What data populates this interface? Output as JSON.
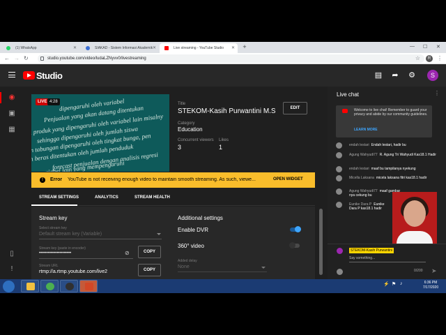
{
  "browser": {
    "tabs": [
      {
        "label": "(1) WhatsApp",
        "icon": "whatsapp-icon",
        "color": "#25d366"
      },
      {
        "label": "SIAKAD - Sistem Informasi Akademik",
        "icon": "siakad-icon",
        "color": "#3b6fd4"
      },
      {
        "label": "Live streaming - YouTube Studio",
        "icon": "youtube-icon",
        "color": "#ff0000"
      }
    ],
    "url": "studio.youtube.com/video/ludaLZNyvv0/livestreaming",
    "profile_initial": "R"
  },
  "studio": {
    "logo_text": "Studio",
    "avatar_initial": "S"
  },
  "stream": {
    "live_label": "LIVE",
    "live_time": "4:28",
    "title_label": "Title",
    "title": "STEKOM-Kasih Purwantini M.Si-...",
    "edit_label": "EDIT",
    "category_label": "Category",
    "category": "Education",
    "viewers_label": "Concurrent viewers",
    "viewers": "3",
    "likes_label": "Likes",
    "likes": "1",
    "preview_lines": [
      "dipengaruhi oleh variabel",
      "Penjualan yang akan datang ditentukan",
      "n produk yang dipengaruhi oleh variabel lain misalny",
      "sehingga dipengaruhi oleh jumlah siswa",
      "an tabungan dipengaruhi oleh tingkat bunga, pen",
      "n beras ditentukan oleh jumlah penduduk",
      "forecast penjualan dengan analisis regresi",
      "kut: variabel lain yang mempengaruhi"
    ]
  },
  "error": {
    "label": "Error",
    "message": "YouTube is not receiving enough video to maintain smooth streaming. As such, viewe...",
    "action": "OPEN WIDGET"
  },
  "tabs": [
    "STREAM SETTINGS",
    "ANALYTICS",
    "STREAM HEALTH"
  ],
  "settings": {
    "stream_key_heading": "Stream key",
    "select_key_label": "Select stream key",
    "select_key_value": "Default stream key (Variable)",
    "key_paste_label": "Stream key (paste in encoder)",
    "key_masked": "••••••••••••••••••••••",
    "copy_label": "COPY",
    "url_label": "Stream URL",
    "url_value": "rtmp://a.rtmp.youtube.com/live2",
    "copy2_label": "COPY",
    "additional_heading": "Additional settings",
    "dvr_label": "Enable DVR",
    "dvr_on": true,
    "video360_label": "360° video",
    "video360_on": false,
    "delay_label": "Added delay",
    "delay_value": "None"
  },
  "chat": {
    "title": "Live chat",
    "welcome": "Welcome to live chat! Remember to guard your privacy and abide by our community guidelines.",
    "learn_more": "LEARN MORE",
    "messages": [
      {
        "author": "endah lestari",
        "text": "Endah lestari, hadir bu"
      },
      {
        "author": "Agung Wahyudi77",
        "text": "R. Agung Tri Wahyudi Kas18.1 Hadir"
      },
      {
        "author": "endah lestari",
        "text": "maaf bu tampilanya nyekung"
      },
      {
        "author": "Micella Laksana",
        "text": "micela laksana fitri kas18.1 hadir"
      },
      {
        "author": "Agung Wahyudi77",
        "text": "maaf gambar nya cekung bu"
      },
      {
        "author": "Eunike Dara P",
        "text": "Eunike Dara P kas18.1 hadir"
      }
    ],
    "my_name": "STEKOM-Kasih Purwantini",
    "placeholder": "Say something...",
    "char_count": "0/200"
  },
  "taskbar": {
    "time": "6:36 PM",
    "date": "7/17/2020",
    "apps": [
      {
        "name": "file-explorer-icon",
        "color": "#f0c040"
      },
      {
        "name": "chrome-icon",
        "color": "#4caf50"
      },
      {
        "name": "obs-icon",
        "color": "#303030"
      },
      {
        "name": "powerpoint-icon",
        "color": "#d24726"
      }
    ]
  }
}
